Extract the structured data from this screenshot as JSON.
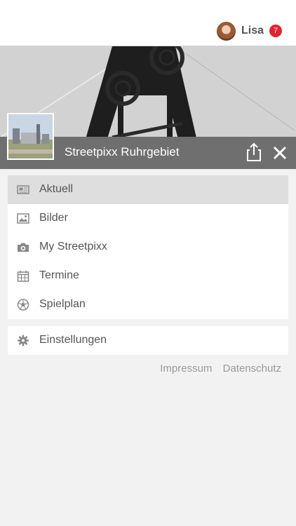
{
  "user": {
    "name": "Lisa",
    "notifications": "7"
  },
  "site": {
    "title": "Streetpixx Ruhrgebiet"
  },
  "menu": [
    {
      "label": "Aktuell",
      "icon": "newspaper-icon",
      "active": true
    },
    {
      "label": "Bilder",
      "icon": "image-icon"
    },
    {
      "label": "My Streetpixx",
      "icon": "camera-icon"
    },
    {
      "label": "Termine",
      "icon": "calendar-icon"
    },
    {
      "label": "Spielplan",
      "icon": "soccer-ball-icon"
    }
  ],
  "settings": {
    "label": "Einstellungen",
    "icon": "gear-icon"
  },
  "footer": {
    "impressum": "Impressum",
    "datenschutz": "Datenschutz"
  },
  "colors": {
    "badge": "#e3232f",
    "title_bar": "#6f6f6f",
    "active_item": "#dedede"
  }
}
